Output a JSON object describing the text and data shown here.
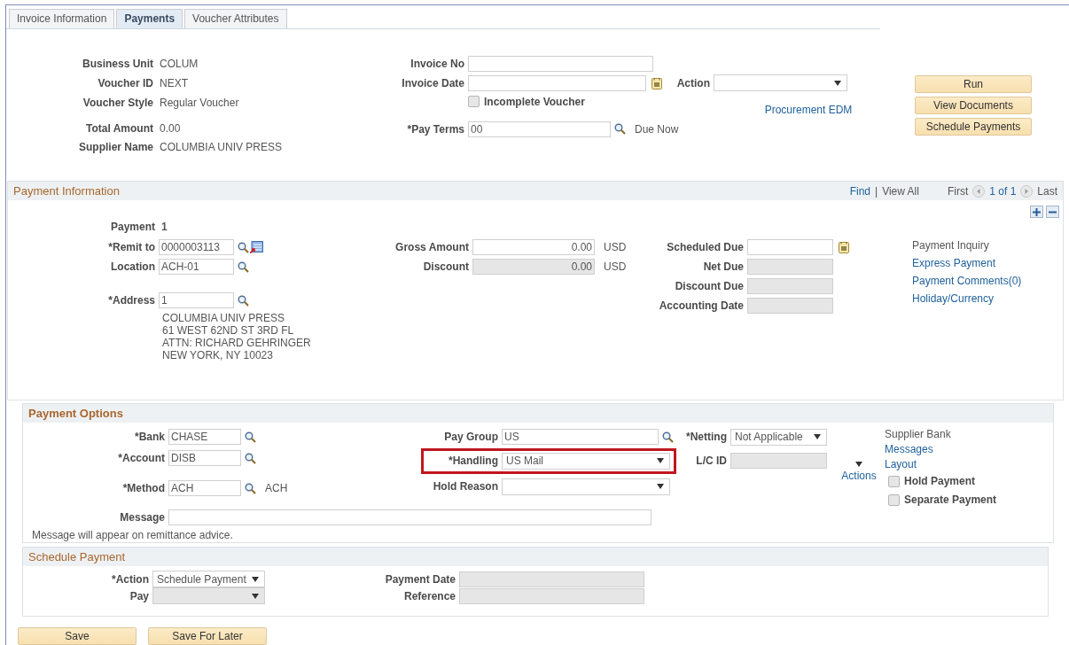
{
  "tabs": [
    {
      "label": "Invoice Information",
      "selected": false
    },
    {
      "label": "Payments",
      "selected": true
    },
    {
      "label": "Voucher Attributes",
      "selected": false
    }
  ],
  "summary": [
    {
      "label": "Business Unit",
      "value": "COLUM"
    },
    {
      "label": "Voucher ID",
      "value": "NEXT"
    },
    {
      "label": "Voucher Style",
      "value": "Regular Voucher"
    },
    {
      "label": "Total Amount",
      "value": "0.00"
    },
    {
      "label": "Supplier Name",
      "value": "COLUMBIA UNIV PRESS"
    }
  ],
  "invoice_fields": [
    {
      "kind": "text_field",
      "label": "Invoice No"
    },
    {
      "kind": "date_field",
      "label": "Invoice Date"
    },
    {
      "kind": "checkbox",
      "label": "Incomplete Voucher",
      "checked": false
    },
    {
      "kind": "lookup_field",
      "label": "*Pay Terms",
      "value": "00",
      "note": "Due Now"
    }
  ],
  "action": {
    "kind": "dropdown",
    "label": "Action"
  },
  "action_link": "Procurement EDM",
  "buttons": [
    "Run",
    "View Documents",
    "Schedule Payments"
  ],
  "payment_information": {
    "title": "Payment Information",
    "find": "Find",
    "separator": "|",
    "view_all": "View All",
    "first": "First",
    "count": "1 of 1",
    "last": "Last",
    "payment_label": "Payment",
    "payment_value": "1",
    "left_fields": [
      {
        "kind": "lookup_field",
        "label": "*Remit to",
        "value": "0000003113",
        "detail_icon": true
      },
      {
        "kind": "lookup_field",
        "label": "Location",
        "value": "ACH-01"
      },
      {
        "kind": "lookup_field",
        "label": "*Address",
        "value": "1"
      }
    ],
    "address_lines": [
      "COLUMBIA UNIV PRESS",
      "61 WEST 62ND ST 3RD FL",
      "ATTN: RICHARD GEHRINGER",
      "NEW YORK, NY  10023"
    ],
    "amounts": [
      {
        "kind": "amount_field",
        "label": "Gross Amount",
        "value": "0.00",
        "note": "USD",
        "disabled": false
      },
      {
        "kind": "amount_field",
        "label": "Discount",
        "value": "0.00",
        "note": "USD",
        "disabled": true
      }
    ],
    "dates": [
      {
        "kind": "date_field",
        "label": "Scheduled Due"
      },
      {
        "kind": "text_field",
        "label": "Net Due",
        "disabled": true
      },
      {
        "kind": "text_field",
        "label": "Discount Due",
        "disabled": true
      },
      {
        "kind": "text_field",
        "label": "Accounting Date",
        "disabled": true
      }
    ],
    "side_title": "Payment Inquiry",
    "side_links": [
      "Express Payment",
      "Payment Comments(0)",
      "Holiday/Currency"
    ]
  },
  "payment_options": {
    "title": "Payment Options",
    "left_fields": [
      {
        "kind": "lookup_field",
        "label": "*Bank",
        "value": "CHASE"
      },
      {
        "kind": "lookup_field",
        "label": "*Account",
        "value": "DISB"
      },
      {
        "kind": "lookup_field",
        "label": "*Method",
        "value": "ACH",
        "note": "ACH"
      }
    ],
    "middle_fields": [
      {
        "kind": "lookup_field",
        "label": "Pay Group",
        "value": "US"
      },
      {
        "kind": "dropdown",
        "label": "*Handling",
        "value": "US Mail",
        "highlighted": true
      },
      {
        "kind": "dropdown",
        "label": "Hold Reason"
      }
    ],
    "right_fields": [
      {
        "kind": "dropdown",
        "label": "*Netting",
        "value": "Not Applicable"
      },
      {
        "kind": "text_field",
        "label": "L/C ID",
        "disabled": true
      }
    ],
    "actions": "Actions",
    "side_title": "Supplier Bank",
    "side_links": [
      "Messages",
      "Layout"
    ],
    "checkboxes": [
      {
        "label": "Hold Payment",
        "checked": false
      },
      {
        "label": "Separate Payment",
        "checked": false
      }
    ],
    "message": {
      "kind": "text_field",
      "label": "Message"
    },
    "note": "Message will appear on remittance advice."
  },
  "schedule_payment": {
    "title": "Schedule Payment",
    "left_fields": [
      {
        "kind": "dropdown",
        "label": "*Action",
        "value": "Schedule Payment"
      },
      {
        "kind": "dropdown",
        "label": "Pay",
        "disabled": true
      }
    ],
    "right_fields": [
      {
        "kind": "text_field",
        "label": "Payment Date",
        "disabled": true
      },
      {
        "kind": "text_field",
        "label": "Reference",
        "disabled": true
      }
    ]
  },
  "footer_buttons": [
    "Save",
    "Save For Later"
  ]
}
